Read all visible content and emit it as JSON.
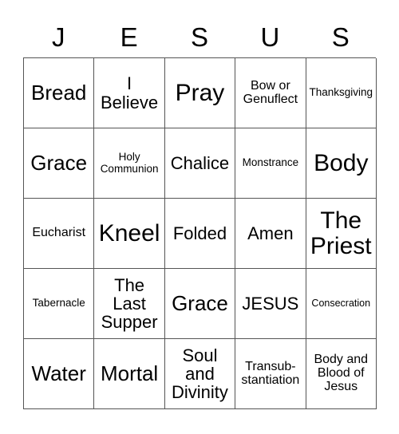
{
  "card": {
    "title_letters": [
      "J",
      "E",
      "S",
      "U",
      "S"
    ],
    "columns": 5,
    "rows": 5,
    "border_color": "#555555",
    "text_color": "#000000",
    "background_color": "#ffffff",
    "cells": [
      [
        {
          "label": "Bread",
          "size": "lg"
        },
        {
          "label": "I\nBelieve",
          "size": "md"
        },
        {
          "label": "Pray",
          "size": "xl"
        },
        {
          "label": "Bow or\nGenuflect",
          "size": "sm"
        },
        {
          "label": "Thanksgiving",
          "size": "xs"
        }
      ],
      [
        {
          "label": "Grace",
          "size": "lg"
        },
        {
          "label": "Holy\nCommunion",
          "size": "xs"
        },
        {
          "label": "Chalice",
          "size": "md"
        },
        {
          "label": "Monstrance",
          "size": "xs"
        },
        {
          "label": "Body",
          "size": "xl"
        }
      ],
      [
        {
          "label": "Eucharist",
          "size": "sm"
        },
        {
          "label": "Kneel",
          "size": "xl"
        },
        {
          "label": "Folded",
          "size": "md"
        },
        {
          "label": "Amen",
          "size": "md"
        },
        {
          "label": "The\nPriest",
          "size": "xl"
        }
      ],
      [
        {
          "label": "Tabernacle",
          "size": "xs"
        },
        {
          "label": "The\nLast\nSupper",
          "size": "md"
        },
        {
          "label": "Grace",
          "size": "lg"
        },
        {
          "label": "JESUS",
          "size": "md"
        },
        {
          "label": "Consecration",
          "size": "xxs"
        }
      ],
      [
        {
          "label": "Water",
          "size": "lg"
        },
        {
          "label": "Mortal",
          "size": "lg"
        },
        {
          "label": "Soul\nand\nDivinity",
          "size": "md"
        },
        {
          "label": "Transub-\nstantiation",
          "size": "sm"
        },
        {
          "label": "Body and\nBlood of\nJesus",
          "size": "sm"
        }
      ]
    ]
  }
}
